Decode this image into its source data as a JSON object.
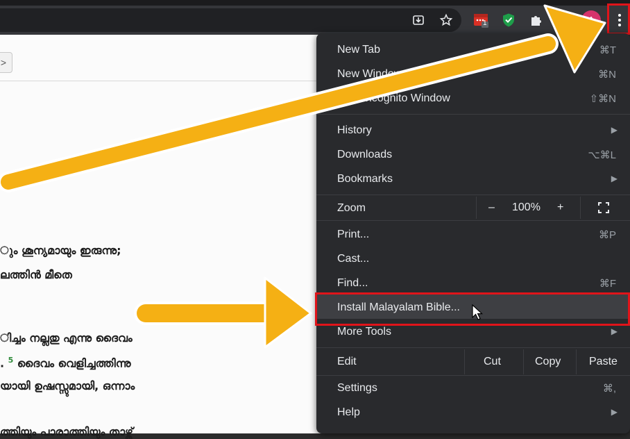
{
  "toolbar": {
    "icons": [
      "install-app-icon",
      "bookmark-star-icon",
      "calendar-extension-icon",
      "shield-check-extension-icon",
      "puzzle-extensions-icon",
      "profile-avatar",
      "kebab-menu-icon"
    ],
    "extension_badge": "1",
    "avatar_letter": "A",
    "colors": {
      "avatar": "#d6336c",
      "shield": "#1e9e4a",
      "calendar": "#d93025"
    }
  },
  "page": {
    "nav_button_label": ">",
    "lines": [
      "ും ശൂന്യമായും ഇരുന്നു;",
      "ലത്തിൻ മീതെ",
      "ിച്ചം നല്ലതു എന്നു ദൈവം",
      "ദൈവം വെളിച്ചത്തിന്നു",
      "യായി ഉഷസ്സുമായി, ഒന്നാം",
      "ത്തിയും പാരാത്തിയും താഴ്ത്"
    ],
    "line4_prefix": ".",
    "line4_verse": "5"
  },
  "menu": {
    "new_tab": {
      "label": "New Tab",
      "shortcut": "⌘T"
    },
    "new_window": {
      "label": "New Window",
      "shortcut": "⌘N"
    },
    "incognito": {
      "label": "New Incognito Window",
      "shortcut": "⇧⌘N"
    },
    "history": {
      "label": "History"
    },
    "downloads": {
      "label": "Downloads",
      "shortcut": "⌥⌘L"
    },
    "bookmarks": {
      "label": "Bookmarks"
    },
    "zoom": {
      "label": "Zoom",
      "minus": "–",
      "value": "100%",
      "plus": "+"
    },
    "print": {
      "label": "Print...",
      "shortcut": "⌘P"
    },
    "cast": {
      "label": "Cast..."
    },
    "find": {
      "label": "Find...",
      "shortcut": "⌘F"
    },
    "install": {
      "label": "Install Malayalam Bible..."
    },
    "more_tools": {
      "label": "More Tools"
    },
    "edit": {
      "label": "Edit",
      "cut": "Cut",
      "copy": "Copy",
      "paste": "Paste"
    },
    "settings": {
      "label": "Settings",
      "shortcut": "⌘,"
    },
    "help": {
      "label": "Help"
    },
    "submenu_arrow": "▶"
  },
  "annotation": {
    "arrow_color": "#f5b014",
    "arrow_outline": "#ffffff",
    "highlight_color": "#e0141a"
  }
}
